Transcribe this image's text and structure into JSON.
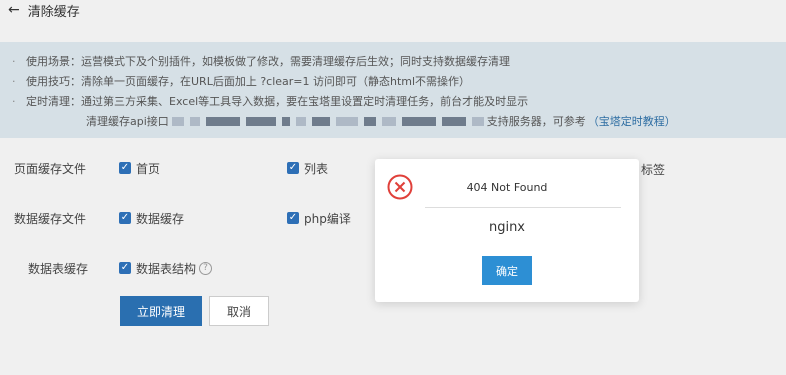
{
  "header": {
    "back_icon": "left-arrow-icon",
    "back_glyph": "←",
    "title": "清除缓存"
  },
  "tips": [
    {
      "prefix": "使用场景：",
      "text": "运营模式下及个别插件，如模板做了修改，需要清理缓存后生效；同时支持数据缓存清理"
    },
    {
      "prefix": "使用技巧：",
      "text": "清除单一页面缓存，在URL后面加上 ?clear=1 访问即可（静态html不需操作）"
    },
    {
      "prefix": "定时清理：",
      "text": "通过第三方采集、Excel等工具导入数据，要在宝塔里设置定时清理任务，前台才能及时显示"
    },
    {
      "prefix": "清理缓存api接口",
      "suffix": "支持服务器，可参考",
      "link": "（宝塔定时教程）"
    }
  ],
  "form": {
    "page_cache": {
      "label": "页面缓存文件",
      "options": [
        "首页",
        "列表"
      ],
      "trailing": "标签"
    },
    "data_cache": {
      "label": "数据缓存文件",
      "options": [
        "数据缓存",
        "php编译"
      ]
    },
    "table_cache": {
      "label": "数据表缓存",
      "options": [
        "数据表结构"
      ],
      "help_icon": "help-circle-icon",
      "help_glyph": "?"
    }
  },
  "checkbox_glyph": "✓",
  "buttons": {
    "submit": "立即清理",
    "cancel": "取消"
  },
  "modal": {
    "icon": "error-circle-icon",
    "title": "404 Not Found",
    "body": "nginx",
    "ok_label": "确定"
  },
  "colors": {
    "primary": "#2a6fb0",
    "error": "#e0403a",
    "tips_bg": "#d6e0e6"
  }
}
